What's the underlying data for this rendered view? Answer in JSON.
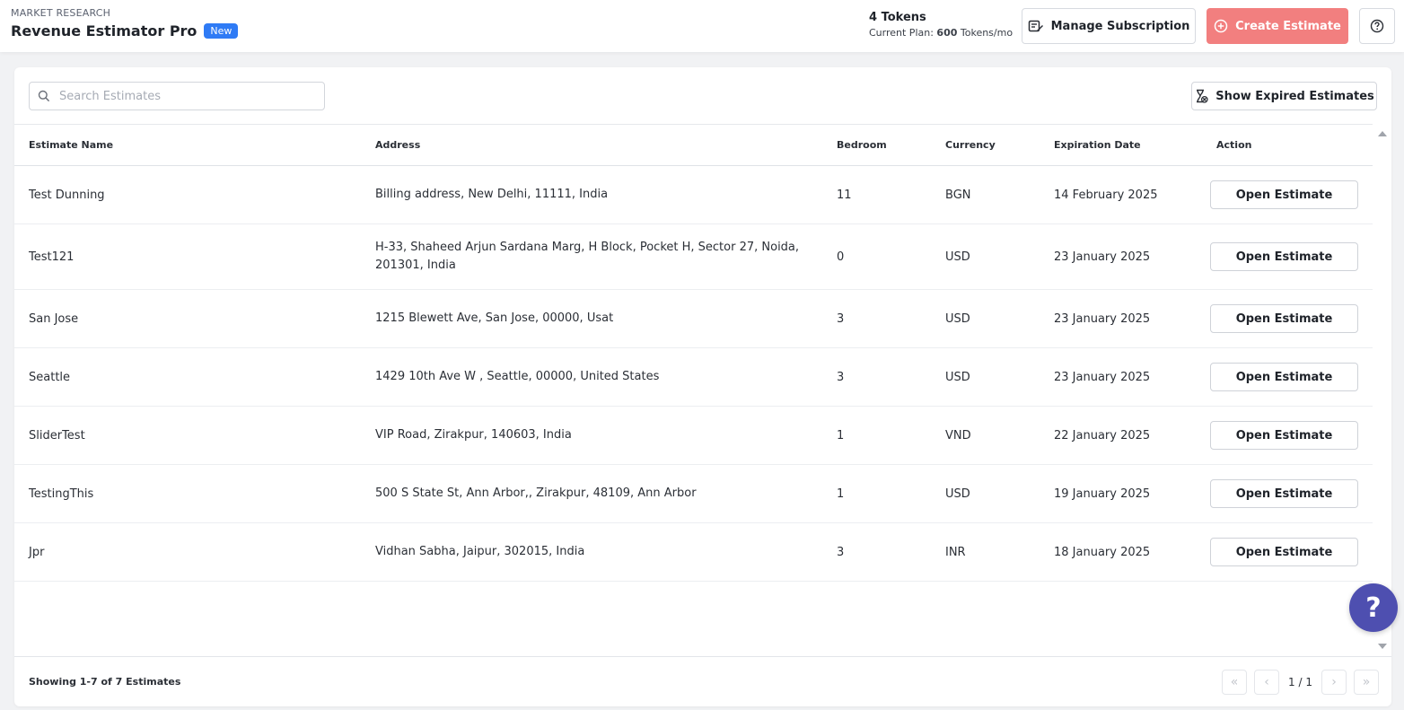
{
  "header": {
    "eyebrow": "MARKET RESEARCH",
    "title": "Revenue Estimator Pro",
    "badge": "New",
    "tokens": "4 Tokens",
    "plan_prefix": "Current Plan: ",
    "plan_amount": "600",
    "plan_suffix": " Tokens/mo",
    "manage_label": "Manage Subscription",
    "create_label": "Create Estimate"
  },
  "toolbar": {
    "search_placeholder": "Search Estimates",
    "expired_label": "Show Expired Estimates"
  },
  "table": {
    "columns": [
      "Estimate Name",
      "Address",
      "Bedroom",
      "Currency",
      "Expiration Date",
      "Action"
    ],
    "rows": [
      {
        "name": "Test Dunning",
        "address": "Billing address, New Delhi, 11111, India",
        "bedroom": "11",
        "currency": "BGN",
        "expiration": "14 February 2025",
        "action": "Open Estimate"
      },
      {
        "name": "Test121",
        "address": "H-33, Shaheed Arjun Sardana Marg, H Block, Pocket H, Sector 27, Noida, 201301, India",
        "bedroom": "0",
        "currency": "USD",
        "expiration": "23 January 2025",
        "action": "Open Estimate"
      },
      {
        "name": "San Jose",
        "address": "1215 Blewett Ave, San Jose, 00000, Usat",
        "bedroom": "3",
        "currency": "USD",
        "expiration": "23 January 2025",
        "action": "Open Estimate"
      },
      {
        "name": "Seattle",
        "address": "1429 10th Ave W , Seattle, 00000, United States",
        "bedroom": "3",
        "currency": "USD",
        "expiration": "23 January 2025",
        "action": "Open Estimate"
      },
      {
        "name": "SliderTest",
        "address": "VIP Road, Zirakpur, 140603, India",
        "bedroom": "1",
        "currency": "VND",
        "expiration": "22 January 2025",
        "action": "Open Estimate"
      },
      {
        "name": "TestingThis",
        "address": "500 S State St, Ann Arbor,, Zirakpur, 48109, Ann Arbor",
        "bedroom": "1",
        "currency": "USD",
        "expiration": "19 January 2025",
        "action": "Open Estimate"
      },
      {
        "name": "Jpr",
        "address": "Vidhan Sabha, Jaipur, 302015, India",
        "bedroom": "3",
        "currency": "INR",
        "expiration": "18 January 2025",
        "action": "Open Estimate"
      }
    ]
  },
  "footer": {
    "showing": "Showing 1-7 of 7 Estimates",
    "page": "1 / 1"
  },
  "icons": {
    "manage": "edit-card-icon",
    "create": "plus-circle-icon",
    "help": "question-circle-icon",
    "search": "search-icon",
    "expired": "hourglass-off-icon",
    "chat": "question-bubble-icon"
  },
  "colors": {
    "accent_badge": "#2f7bf5",
    "create_button": "#f27f7f",
    "help_bubble": "#4e4fb0"
  }
}
